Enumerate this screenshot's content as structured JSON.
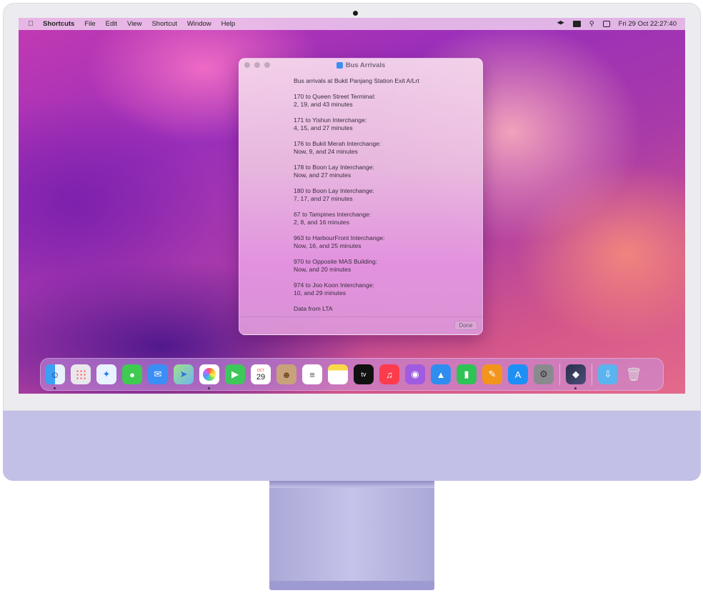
{
  "menubar": {
    "app_name": "Shortcuts",
    "items": [
      "File",
      "Edit",
      "View",
      "Shortcut",
      "Window",
      "Help"
    ],
    "clock": "Fri 29 Oct  22:27:40"
  },
  "window": {
    "title": "Bus Arrivals",
    "header": "Bus arrivals at Bukit Panjang Station Exit A/Lrt",
    "arrivals": [
      {
        "route": "170 to Queen Street Terminal:",
        "times": "2, 19, and 43 minutes"
      },
      {
        "route": "171 to Yishun Interchange:",
        "times": "4, 15, and 27 minutes"
      },
      {
        "route": "176 to Bukit Merah Interchange:",
        "times": "Now, 9, and 24 minutes"
      },
      {
        "route": "178 to Boon Lay Interchange:",
        "times": "Now, and 27 minutes"
      },
      {
        "route": "180 to Boon Lay Interchange:",
        "times": "7, 17, and 27 minutes"
      },
      {
        "route": "67 to Tampines Interchange:",
        "times": "2, 8, and 16 minutes"
      },
      {
        "route": "963 to HarbourFront Interchange:",
        "times": "Now, 16, and 25 minutes"
      },
      {
        "route": "970 to Opposite MAS Building:",
        "times": "Now, and 20 minutes"
      },
      {
        "route": "974 to Joo Koon Interchange:",
        "times": "10, and 29 minutes"
      }
    ],
    "source": "Data from LTA",
    "done_label": "Done"
  },
  "dock": {
    "calendar_month": "OCT",
    "calendar_day": "29",
    "tv_label": "tv"
  }
}
